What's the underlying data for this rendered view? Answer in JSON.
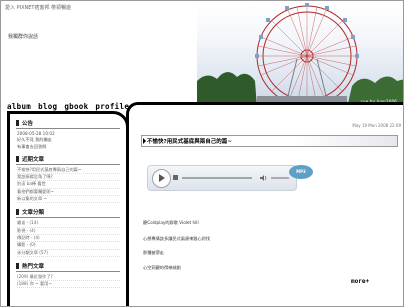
{
  "page": {
    "top_title": "愛入 PIXNET痞客邦 帶領暢遊",
    "subtitle": "我獨群你說話",
    "photo_credit": "cue by Ivan2006"
  },
  "nav": [
    "album",
    "blog",
    "gbook",
    "profile"
  ],
  "sidebar": {
    "sections": [
      {
        "title": "公告",
        "lines": [
          "2008-05-28 10:02",
          "好久不見 我的獨友",
          "有事會去回答問"
        ]
      },
      {
        "title": "近期文章",
        "lines": [
          "不愉快?用民式基底專兩自己的篇~",
          "我該搞揚呈角了嗎?",
          "別這 ba棒 看世",
          "看他們都要獨愛呢~",
          "新以集的文章 ~"
        ]
      },
      {
        "title": "文章分類",
        "lines": [
          "雜谈 - (14)",
          "影視 - (4)",
          "傳記時 - (4)",
          "攝影 - (0)",
          "未分類文章 (57)"
        ]
      },
      {
        "title": "熱門文章",
        "lines": [
          "(209) 最近發作了?",
          "(188) 你 ~ 要用~"
        ]
      }
    ]
  },
  "post": {
    "date": "May 19 Mon 2008 22:09",
    "title": "不愉快?用民式基底與兩自己的篇~",
    "player_badge": "MP3",
    "lines": [
      "聽Coldplay的群歌 Violet hill",
      "心想專情該多讓民式風源來跟心對找",
      "那種被帶走",
      "心空洞觀的得神絨劇"
    ],
    "more_label": "more+"
  },
  "colors": {
    "border": "#000000",
    "accent": "#5d9fc7"
  }
}
